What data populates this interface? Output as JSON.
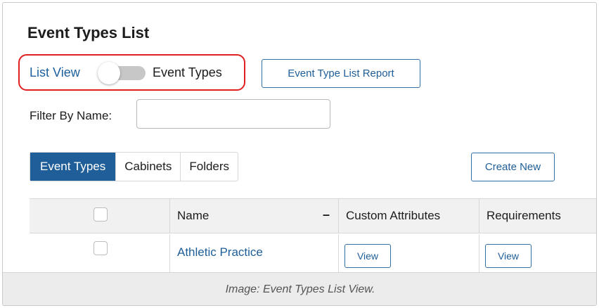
{
  "page": {
    "title": "Event Types List"
  },
  "view_toggle": {
    "left_label": "List View",
    "right_label": "Event Types",
    "state": "off"
  },
  "toolbar": {
    "report_label": "Event Type List Report",
    "create_label": "Create New"
  },
  "filter": {
    "label": "Filter By Name:",
    "value": "",
    "placeholder": ""
  },
  "tabs": [
    {
      "label": "Event Types",
      "active": true
    },
    {
      "label": "Cabinets",
      "active": false
    },
    {
      "label": "Folders",
      "active": false
    }
  ],
  "table": {
    "columns": [
      "",
      "Name",
      "Custom Attributes",
      "Requirements"
    ],
    "sort_indicator": "–",
    "rows": [
      {
        "name": "Athletic Practice",
        "custom_attributes_action": "View",
        "requirements_action": "View"
      }
    ]
  },
  "caption": "Image: Event Types List View.",
  "colors": {
    "accent": "#1f5e98",
    "highlight": "#e02020",
    "header_bg": "#f1f1f1"
  }
}
